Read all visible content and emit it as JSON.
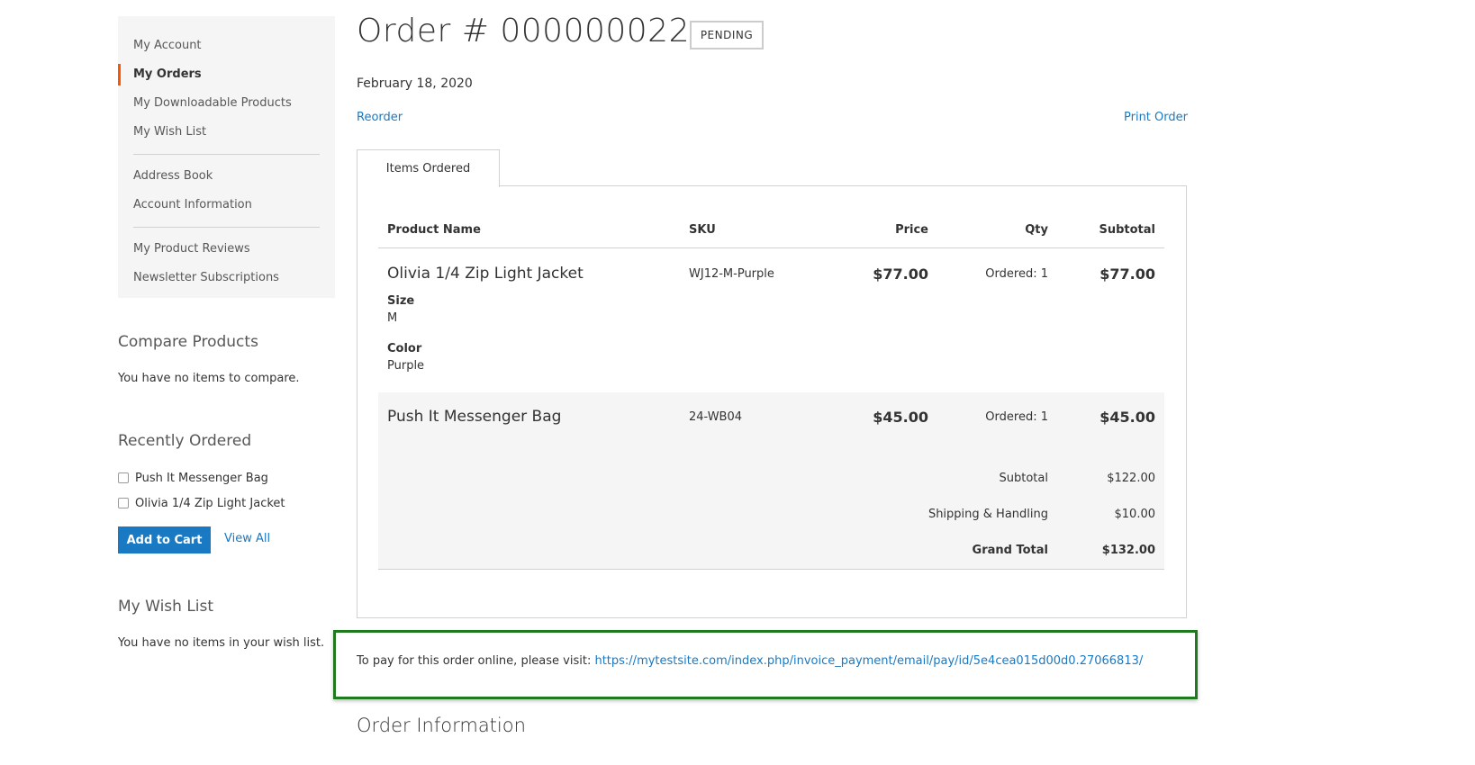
{
  "sidebar": {
    "group1": [
      {
        "label": "My Account",
        "active": false
      },
      {
        "label": "My Orders",
        "active": true
      },
      {
        "label": "My Downloadable Products",
        "active": false
      },
      {
        "label": "My Wish List",
        "active": false
      }
    ],
    "group2": [
      {
        "label": "Address Book"
      },
      {
        "label": "Account Information"
      }
    ],
    "group3": [
      {
        "label": "My Product Reviews"
      },
      {
        "label": "Newsletter Subscriptions"
      }
    ]
  },
  "compare": {
    "title": "Compare Products",
    "empty_text": "You have no items to compare."
  },
  "recently_ordered": {
    "title": "Recently Ordered",
    "items": [
      "Push It Messenger Bag",
      "Olivia 1/4 Zip Light Jacket"
    ],
    "add_to_cart": "Add to Cart",
    "view_all": "View All"
  },
  "wishlist": {
    "title": "My Wish List",
    "empty_text": "You have no items in your wish list."
  },
  "order": {
    "title": "Order # 000000022",
    "status": "PENDING",
    "date": "February 18, 2020",
    "reorder": "Reorder",
    "print": "Print Order",
    "tab": "Items Ordered",
    "columns": {
      "name": "Product Name",
      "sku": "SKU",
      "price": "Price",
      "qty": "Qty",
      "subtotal": "Subtotal"
    },
    "items": [
      {
        "name": "Olivia 1/4 Zip Light Jacket",
        "sku": "WJ12-M-Purple",
        "price": "$77.00",
        "qty": "Ordered: 1",
        "subtotal": "$77.00",
        "options": [
          {
            "label": "Size",
            "value": "M"
          },
          {
            "label": "Color",
            "value": "Purple"
          }
        ]
      },
      {
        "name": "Push It Messenger Bag",
        "sku": "24-WB04",
        "price": "$45.00",
        "qty": "Ordered: 1",
        "subtotal": "$45.00"
      }
    ],
    "totals": [
      {
        "label": "Subtotal",
        "value": "$122.00"
      },
      {
        "label": "Shipping & Handling",
        "value": "$10.00"
      },
      {
        "label": "Grand Total",
        "value": "$132.00"
      }
    ],
    "payment_prefix": "To pay for this order online, please visit: ",
    "payment_url": "https://mytestsite.com/index.php/invoice_payment/email/pay/id/5e4cea015d00d0.27066813/",
    "info_title": "Order Information"
  },
  "colors": {
    "link": "#1979c3",
    "active_marker": "#ff5501",
    "highlight_border": "#1f7a1f"
  }
}
